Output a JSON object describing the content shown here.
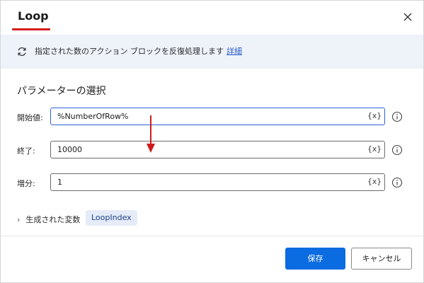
{
  "dialog": {
    "title": "Loop",
    "banner": {
      "text": "指定された数のアクション ブロックを反復処理します",
      "link": "詳細"
    },
    "section_title": "パラメーターの選択",
    "fields": [
      {
        "label": "開始値:",
        "value": "%NumberOfRow%",
        "var_button": "{x}"
      },
      {
        "label": "終了:",
        "value": "10000",
        "var_button": "{x}"
      },
      {
        "label": "増分:",
        "value": "1",
        "var_button": "{x}"
      }
    ],
    "generated_vars": {
      "label": "生成された変数",
      "chip": "LoopIndex"
    },
    "buttons": {
      "save": "保存",
      "cancel": "キャンセル"
    }
  },
  "colors": {
    "accent": "#0b6be0",
    "title_underline": "#d01c1c",
    "annotation_arrow": "#d01c1c",
    "banner_bg": "#eef3fa",
    "chip_bg": "#e5ecf8"
  },
  "icons": [
    "close-icon",
    "refresh-loop-icon",
    "info-icon",
    "chevron-right-icon"
  ]
}
